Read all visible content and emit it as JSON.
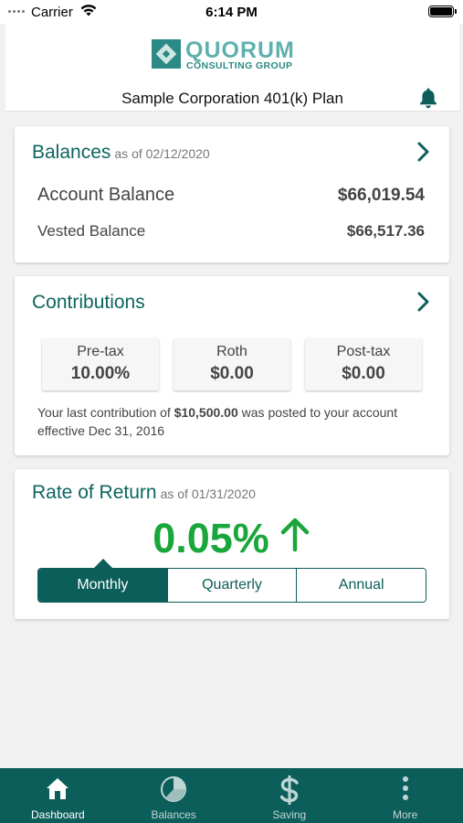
{
  "status_bar": {
    "carrier": "Carrier",
    "time": "6:14 PM"
  },
  "header": {
    "logo_name": "QUORUM",
    "logo_subtitle": "CONSULTING GROUP",
    "plan_title": "Sample Corporation 401(k) Plan",
    "icons": {
      "notifications": "bell-icon"
    }
  },
  "balances": {
    "title": "Balances",
    "as_of": "as of 02/12/2020",
    "account_label": "Account Balance",
    "account_value": "$66,019.54",
    "vested_label": "Vested Balance",
    "vested_value": "$66,517.36"
  },
  "contributions": {
    "title": "Contributions",
    "boxes": [
      {
        "label": "Pre-tax",
        "value": "10.00%"
      },
      {
        "label": "Roth",
        "value": "$0.00"
      },
      {
        "label": "Post-tax",
        "value": "$0.00"
      }
    ],
    "note_prefix": "Your last contribution of ",
    "note_amount": "$10,500.00",
    "note_suffix": " was posted to your account effective Dec 31, 2016"
  },
  "rate_of_return": {
    "title": "Rate of Return",
    "as_of": "as of 01/31/2020",
    "value": "0.05%",
    "trend": "up",
    "periods": [
      "Monthly",
      "Quarterly",
      "Annual"
    ],
    "selected_period": "Monthly"
  },
  "tabbar": {
    "items": [
      {
        "label": "Dashboard",
        "icon": "home-icon"
      },
      {
        "label": "Balances",
        "icon": "pie-chart-icon"
      },
      {
        "label": "Saving",
        "icon": "dollar-icon"
      },
      {
        "label": "More",
        "icon": "more-vertical-icon"
      }
    ],
    "active": "Dashboard"
  },
  "colors": {
    "primary": "#0c5e5a",
    "title_teal": "#0c6560",
    "positive_green": "#19a63a",
    "background": "#f1f1f1"
  }
}
